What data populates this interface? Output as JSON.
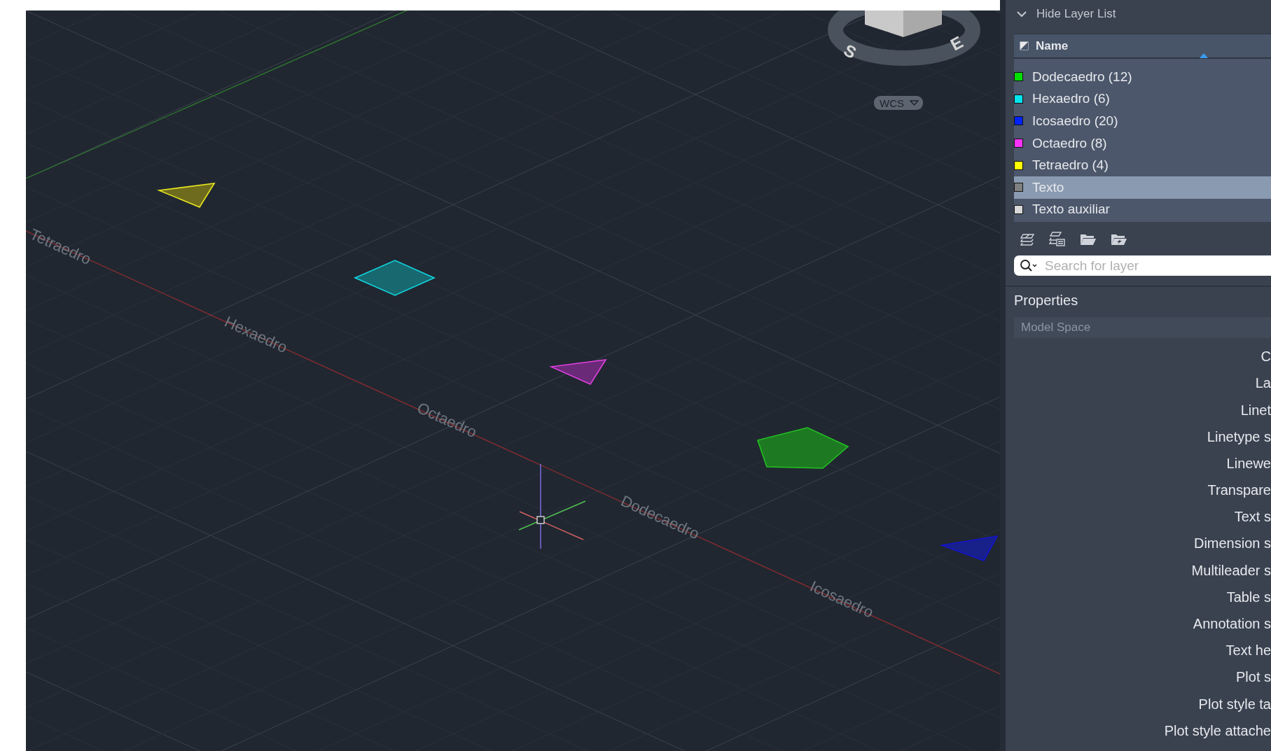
{
  "viewport": {
    "labels": [
      "Tetraedro",
      "Hexaedro",
      "Octaedro",
      "Dodecaedro",
      "Icosaedro"
    ],
    "viewcube": {
      "compass": [
        "S",
        "E"
      ],
      "ucs_button": "WCS"
    }
  },
  "layer_panel": {
    "toggle": "Hide Layer List",
    "header": "Name",
    "layers": [
      {
        "name": "Dodecaedro (12)",
        "color": "#00e000",
        "selected": false
      },
      {
        "name": "Hexaedro (6)",
        "color": "#00e5ee",
        "selected": false
      },
      {
        "name": "Icosaedro (20)",
        "color": "#0022ff",
        "selected": false
      },
      {
        "name": "Octaedro (8)",
        "color": "#ff33ff",
        "selected": false
      },
      {
        "name": "Tetraedro (4)",
        "color": "#ffff00",
        "selected": false
      },
      {
        "name": "Texto",
        "color": "#808080",
        "selected": true
      },
      {
        "name": "Texto auxiliar",
        "color": "#d8d8d8",
        "selected": false
      }
    ],
    "search": {
      "placeholder": "Search for layer"
    }
  },
  "properties": {
    "title": "Properties",
    "context": "Model Space",
    "labels": [
      "C",
      "La",
      "Linet",
      "Linetype s",
      "Linewe",
      "Transpare",
      "Text s",
      "Dimension s",
      "Multileader s",
      "Table s",
      "Annotation s",
      "Text he",
      "Plot s",
      "Plot style ta",
      "Plot style attache"
    ]
  }
}
